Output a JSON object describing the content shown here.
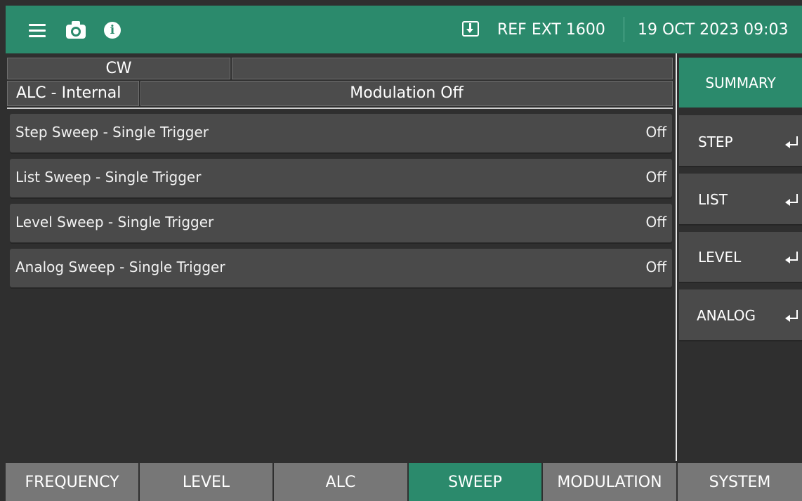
{
  "topbar": {
    "icons": [
      "menu-icon",
      "camera-icon",
      "info-icon",
      "download-icon"
    ],
    "info_glyph": "i",
    "reference": "REF EXT 1600",
    "datetime": "19 OCT 2023 09:03"
  },
  "status": {
    "mode": "CW",
    "alc": "ALC - Internal",
    "modulation": "Modulation Off"
  },
  "sweeps": [
    {
      "label": "Step Sweep - Single Trigger",
      "value": "Off"
    },
    {
      "label": "List Sweep - Single Trigger",
      "value": "Off"
    },
    {
      "label": "Level Sweep - Single Trigger",
      "value": "Off"
    },
    {
      "label": "Analog Sweep - Single Trigger",
      "value": "Off"
    }
  ],
  "softkeys": [
    {
      "label": "SUMMARY",
      "active": true
    },
    {
      "label": "STEP",
      "icon": "enter-icon"
    },
    {
      "label": "LIST",
      "icon": "enter-icon"
    },
    {
      "label": "LEVEL",
      "icon": "enter-icon"
    },
    {
      "label": "ANALOG",
      "icon": "enter-icon"
    }
  ],
  "tabs": [
    {
      "label": "FREQUENCY"
    },
    {
      "label": "LEVEL"
    },
    {
      "label": "ALC"
    },
    {
      "label": "SWEEP",
      "active": true
    },
    {
      "label": "MODULATION"
    },
    {
      "label": "SYSTEM"
    }
  ],
  "colors": {
    "accent": "#2b8a6c",
    "background": "#2f2f2f",
    "panel": "#4a4a4a",
    "tab": "#777777"
  }
}
